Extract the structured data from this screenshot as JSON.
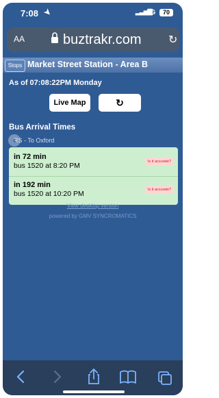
{
  "status_bar": {
    "time": "7:08",
    "network": "5G",
    "battery": "70"
  },
  "url_bar": {
    "text_size_label": "AA",
    "domain": "buztrakr.com"
  },
  "header": {
    "stops_label": "Stops",
    "title": "Market Street Station - Area B"
  },
  "main": {
    "as_of": "As of 07:08:22PM Monday",
    "live_map_label": "Live Map",
    "arrivals_title": "Bus Arrival Times",
    "route_label": "RS - To Oxford",
    "arrivals": [
      {
        "eta": "in 72 min",
        "bus": "bus 1520 at 8:20 PM",
        "accuracy_label": "Is it accurate?"
      },
      {
        "eta": "in 192 min",
        "bus": "bus 1520 at 10:20 PM",
        "accuracy_label": "Is it accurate?"
      }
    ],
    "desktop_link": "View desktop version",
    "powered_by": "powered by GMV SYNCROMATICS"
  },
  "toolbar": {
    "icons": [
      "back-icon",
      "forward-icon",
      "share-icon",
      "bookmarks-icon",
      "tabs-icon"
    ]
  },
  "colors": {
    "page_bg": "#2f5b95",
    "arrival_bg": "#cdefcf",
    "accuracy_bg": "#ffd6d6"
  }
}
